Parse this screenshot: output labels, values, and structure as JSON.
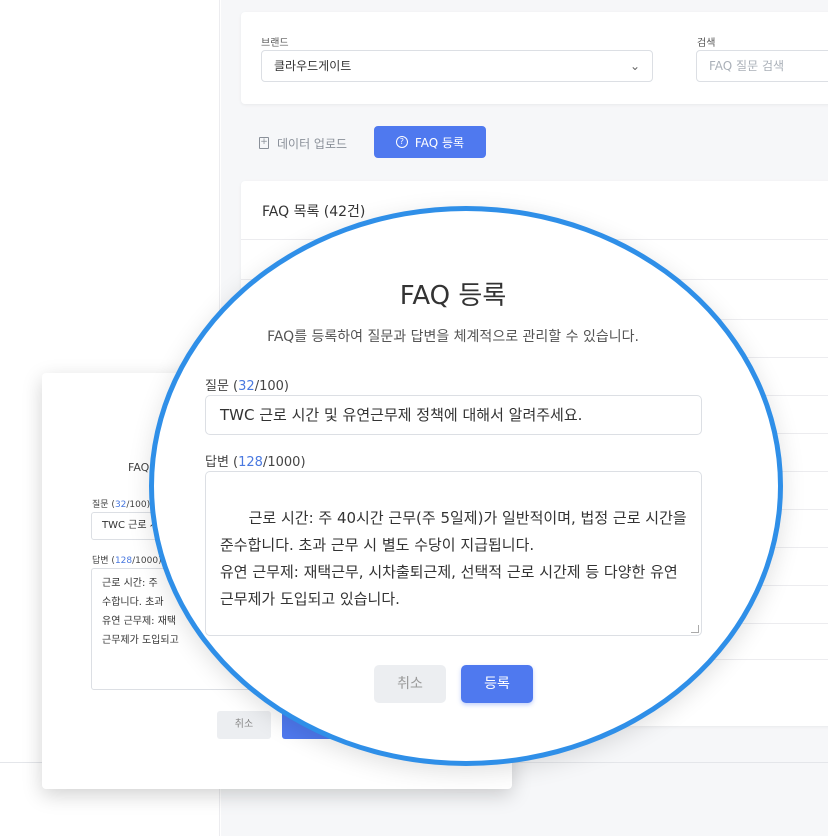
{
  "filters": {
    "brand_label": "브랜드",
    "brand_value": "클라우드게이트",
    "search_label": "검색",
    "search_placeholder": "FAQ 질문 검색"
  },
  "actions": {
    "upload_label": "데이터 업로드",
    "register_label": "FAQ 등록"
  },
  "list": {
    "title": "FAQ 목록 (42건)"
  },
  "modal": {
    "title": "FAQ 등록",
    "subtitle": "FAQ를 등록하여 질문과 답변을 체계적으로 관리할 수 있습니다.",
    "question_label": "질문",
    "question_count": "32",
    "question_max": "/100",
    "question_value": "TWC 근로 시간 및 유연근무제 정책에 대해서 알려주세요.",
    "answer_label": "답변",
    "answer_count": "128",
    "answer_max": "/1000",
    "answer_value": "근로 시간: 주 40시간 근무(주 5일제)가 일반적이며, 법정 근로 시간을 준수합니다. 초과 근무 시 별도 수당이 지급됩니다.\n유연 근무제: 재택근무, 시차출퇴근제, 선택적 근로 시간제 등 다양한 유연 근무제가 도입되고 있습니다.",
    "cancel_label": "취소",
    "submit_label": "등록"
  },
  "small_modal": {
    "title": "FAQ",
    "answer_value": "근로 시간: 주\n수합니다. 초과\n유연 근무제: 재택\n근무제가 도입되고"
  },
  "colors": {
    "accent": "#4f79ef",
    "magnifier_ring": "#2f8fe8",
    "count_blue": "#4a79e0"
  }
}
